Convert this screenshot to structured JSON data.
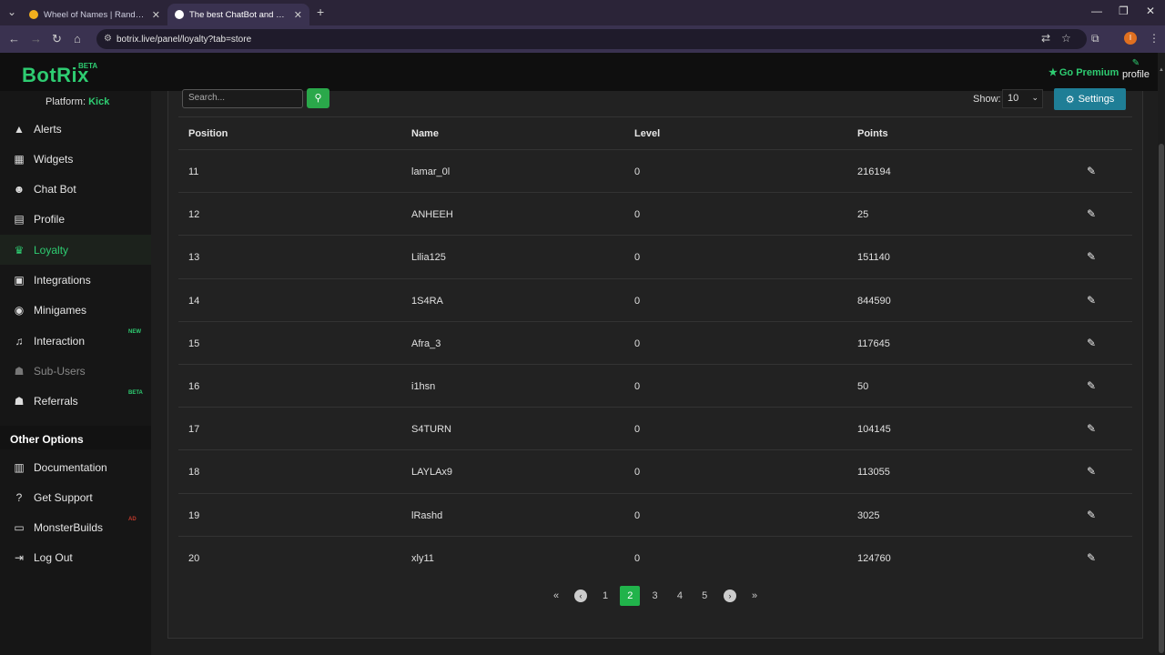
{
  "browser": {
    "tabs": [
      {
        "title": "Wheel of Names | Random name picker",
        "favicon_color": "#f2b01e",
        "close": "✕"
      },
      {
        "title": "The best ChatBot and Widgets for Kick",
        "favicon_color": "#ffffff",
        "close": "✕"
      }
    ],
    "new_tab": "+",
    "url": "botrix.live/panel/loyalty?tab=store",
    "profile_initial": "I"
  },
  "header": {
    "logo": "BotRix",
    "logo_badge": "BETA",
    "premium_label": "Go Premium",
    "profile_label": "profile"
  },
  "sidebar": {
    "platform_label": "Platform:",
    "platform_value": "Kick",
    "items": [
      {
        "label": "Alerts",
        "icon": "warning-icon",
        "glyph": "▲"
      },
      {
        "label": "Widgets",
        "icon": "grid-icon",
        "glyph": "▦"
      },
      {
        "label": "Chat Bot",
        "icon": "robot-icon",
        "glyph": "☻"
      },
      {
        "label": "Profile",
        "icon": "id-card-icon",
        "glyph": "▤"
      },
      {
        "label": "Loyalty",
        "icon": "trophy-icon",
        "glyph": "♛"
      },
      {
        "label": "Integrations",
        "icon": "newspaper-icon",
        "glyph": "▣"
      },
      {
        "label": "Minigames",
        "icon": "gamepad-icon",
        "glyph": "◉"
      },
      {
        "label": "Interaction",
        "icon": "music-icon",
        "glyph": "♫",
        "badge": "NEW",
        "badge_color": "#2ecc71"
      },
      {
        "label": "Sub-Users",
        "icon": "users-icon",
        "glyph": "☗"
      },
      {
        "label": "Referrals",
        "icon": "user-group-icon",
        "glyph": "☗",
        "badge": "BETA",
        "badge_color": "#2ecc71"
      }
    ],
    "other_title": "Other Options",
    "other_items": [
      {
        "label": "Documentation",
        "icon": "book-icon",
        "glyph": "▥"
      },
      {
        "label": "Get Support",
        "icon": "question-icon",
        "glyph": "?"
      },
      {
        "label": "MonsterBuilds",
        "icon": "laptop-icon",
        "glyph": "▭",
        "badge": "AD",
        "badge_color": "#c0392b"
      },
      {
        "label": "Log Out",
        "icon": "logout-icon",
        "glyph": "⇥"
      }
    ]
  },
  "toolbar": {
    "search_placeholder": "Search...",
    "show_label": "Show:",
    "show_value": "10",
    "settings_label": "Settings"
  },
  "table": {
    "columns": [
      "Position",
      "Name",
      "Level",
      "Points"
    ],
    "rows": [
      {
        "position": "11",
        "name": "lamar_0l",
        "level": "0",
        "points": "216194"
      },
      {
        "position": "12",
        "name": "ANHEEH",
        "level": "0",
        "points": "25"
      },
      {
        "position": "13",
        "name": "Lilia125",
        "level": "0",
        "points": "151140"
      },
      {
        "position": "14",
        "name": "1S4RA",
        "level": "0",
        "points": "844590"
      },
      {
        "position": "15",
        "name": "Afra_3",
        "level": "0",
        "points": "117645"
      },
      {
        "position": "16",
        "name": "i1hsn",
        "level": "0",
        "points": "50"
      },
      {
        "position": "17",
        "name": "S4TURN",
        "level": "0",
        "points": "104145"
      },
      {
        "position": "18",
        "name": "LAYLAx9",
        "level": "0",
        "points": "113055"
      },
      {
        "position": "19",
        "name": "lRashd",
        "level": "0",
        "points": "3025"
      },
      {
        "position": "20",
        "name": "xly11",
        "level": "0",
        "points": "124760"
      }
    ]
  },
  "pagination": {
    "first": "«",
    "prev": "‹",
    "pages": [
      "1",
      "2",
      "3",
      "4",
      "5"
    ],
    "current": "2",
    "next": "›",
    "last": "»"
  },
  "colors": {
    "accent": "#2ecc71",
    "settings_button": "#1f7e96",
    "current_page": "#21b34b"
  }
}
